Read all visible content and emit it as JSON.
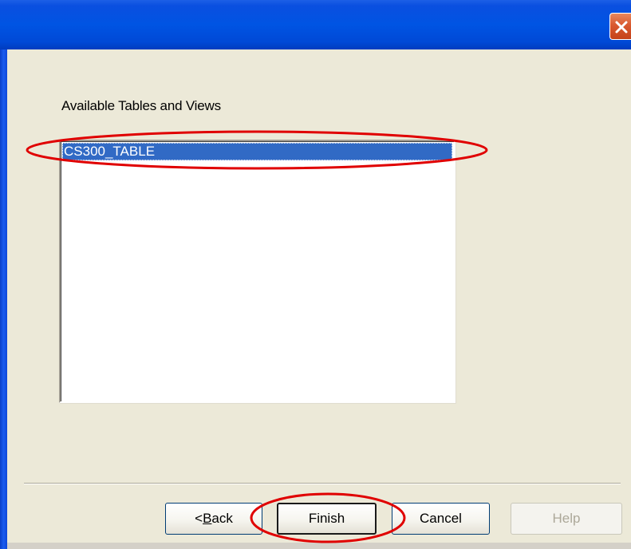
{
  "window": {
    "title_bar_color": "#0054e3",
    "close_icon": "close-icon"
  },
  "main": {
    "tables_label": "Available Tables and Views",
    "list_items": [
      {
        "label": "CS300_TABLE",
        "selected": true
      }
    ]
  },
  "buttons": {
    "back_prefix": "< ",
    "back_mnemonic": "B",
    "back_rest": "ack",
    "finish": "Finish",
    "cancel": "Cancel",
    "help": "Help"
  },
  "annotations": {
    "color": "#e00000",
    "highlighted": [
      "CS300_TABLE",
      "Finish"
    ]
  }
}
